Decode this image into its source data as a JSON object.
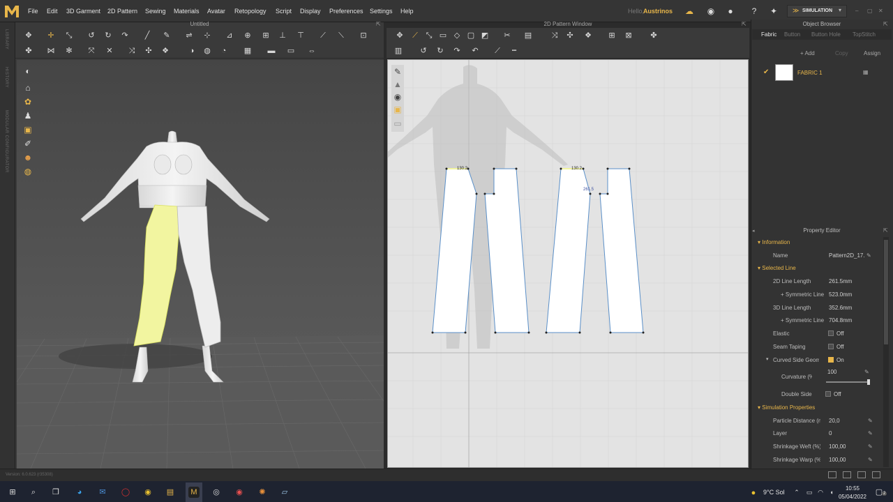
{
  "menu": {
    "items": [
      "File",
      "Edit",
      "3D Garment",
      "2D Pattern",
      "Sewing",
      "Materials",
      "Avatar",
      "Retopology",
      "Script",
      "Display",
      "Preferences",
      "Settings",
      "Help"
    ],
    "hello": "Hello,",
    "username": "Austrinos",
    "mode": "SIMULATION"
  },
  "left_bar": {
    "labels": [
      "LIBRARY",
      "HISTORY",
      "MODULAR CONFIGURATOR"
    ]
  },
  "panel_3d": {
    "title": "Untitled"
  },
  "panel_2d": {
    "title": "2D Pattern Window",
    "measurements": [
      "130.2",
      "130.2",
      "261.5"
    ]
  },
  "object_browser": {
    "title": "Object Browser",
    "tabs": [
      "Fabric",
      "Button",
      "Button Hole",
      "TopStitch"
    ],
    "actions": {
      "add": "+ Add",
      "copy": "Copy",
      "assign": "Assign"
    },
    "fabric_name": "FABRIC 1"
  },
  "property_editor": {
    "title": "Property Editor",
    "information": {
      "header": "Information",
      "name_label": "Name",
      "name_value": "Pattern2D_17..."
    },
    "selected_line": {
      "header": "Selected Line",
      "line2d_label": "2D Line Length",
      "line2d_value": "261.5mm",
      "sym1_label": "+ Symmetric Line",
      "sym1_value": "523.0mm",
      "line3d_label": "3D Line Length",
      "line3d_value": "352.6mm",
      "sym2_label": "+ Symmetric Line",
      "sym2_value": "704.8mm",
      "elastic_label": "Elastic",
      "elastic_value": "Off",
      "seam_label": "Seam Taping",
      "seam_value": "Off",
      "curved_label": "Curved Side Geometry",
      "curved_value": "On",
      "curvature_label": "Curvature (%)",
      "curvature_value": "100",
      "double_label": "Double Side",
      "double_value": "Off"
    },
    "simulation": {
      "header": "Simulation Properties",
      "particle_label": "Particle Distance (mm)",
      "particle_value": "20,0",
      "layer_label": "Layer",
      "layer_value": "0",
      "weft_label": "Shrinkage Weft (%)",
      "weft_value": "100,00",
      "warp_label": "Shrinkage Warp (%)",
      "warp_value": "100,00"
    }
  },
  "status": {
    "version": "Version: 6.0.623 (r35308)"
  },
  "taskbar": {
    "temperature": "9°C Sol",
    "time": "10:55",
    "date": "05/04/2022",
    "notifications": "2"
  },
  "colors": {
    "accent": "#e8b64a",
    "selection": "#f2f5a0",
    "outline": "#5a8fc8"
  }
}
